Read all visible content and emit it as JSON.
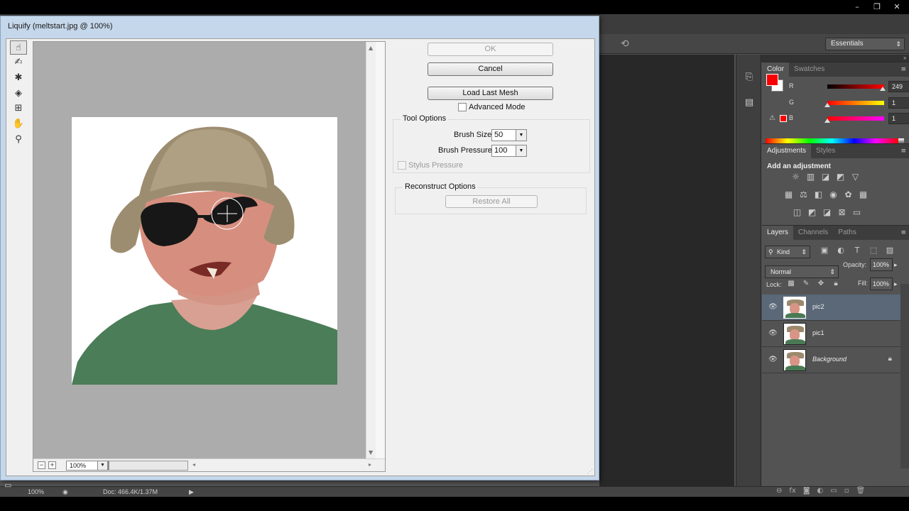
{
  "app": {
    "workspace": "Essentials",
    "window_controls": [
      "–",
      "❐",
      "✕"
    ]
  },
  "color_panel": {
    "tabs": [
      "Color",
      "Swatches"
    ],
    "fg_color": "#f90101",
    "bg_color": "#ffffff",
    "rows": [
      {
        "label": "R",
        "value": "249"
      },
      {
        "label": "G",
        "value": "1"
      },
      {
        "label": "B",
        "value": "1"
      }
    ]
  },
  "adjustments_panel": {
    "tabs": [
      "Adjustments",
      "Styles"
    ],
    "title": "Add an adjustment"
  },
  "layers_panel": {
    "tabs": [
      "Layers",
      "Channels",
      "Paths"
    ],
    "filter_kind": "Kind",
    "blend_mode": "Normal",
    "opacity_label": "Opacity:",
    "opacity": "100%",
    "lock_label": "Lock:",
    "fill_label": "Fill:",
    "fill": "100%",
    "layers": [
      {
        "name": "pic2",
        "selected": true
      },
      {
        "name": "pic1",
        "selected": false
      },
      {
        "name": "Background",
        "selected": false,
        "locked": true
      }
    ]
  },
  "status_bar": {
    "zoom": "100%",
    "doc": "Doc: 466.4K/1.37M"
  },
  "liquify": {
    "title": "Liquify (meltstart.jpg @ 100%)",
    "buttons": {
      "ok": "OK",
      "cancel": "Cancel",
      "load_last_mesh": "Load Last Mesh",
      "restore_all": "Restore All"
    },
    "advanced_mode": "Advanced Mode",
    "tool_options": {
      "title": "Tool Options",
      "brush_size_label": "Brush Size:",
      "brush_size": "50",
      "brush_pressure_label": "Brush Pressure:",
      "brush_pressure": "100",
      "stylus_pressure": "Stylus Pressure"
    },
    "reconstruct_options": {
      "title": "Reconstruct Options"
    },
    "zoom": "100%"
  }
}
